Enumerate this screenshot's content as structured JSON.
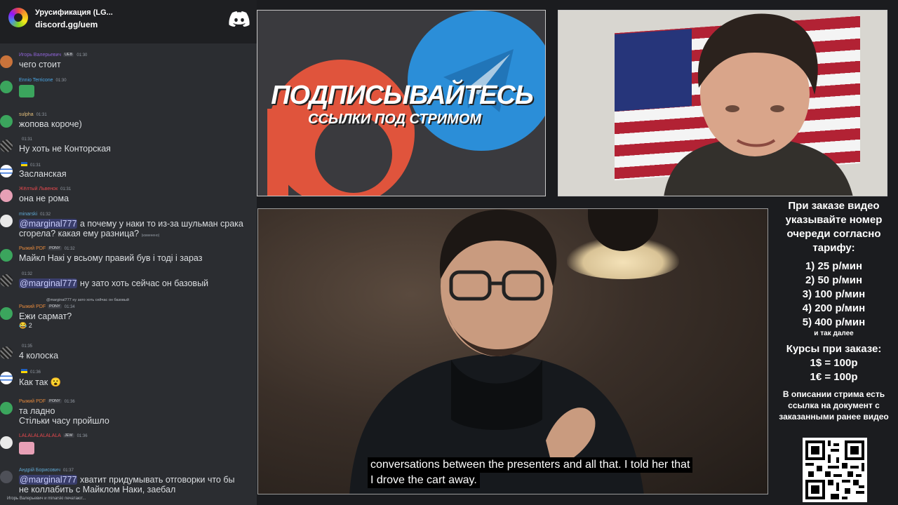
{
  "chat": {
    "server_name": "Урусификация (LG...",
    "invite": "discord.gg/uem",
    "typing": "Игорь Валерьевич и minarski печатают...",
    "messages": [
      {
        "author": "Игорь Валерьевич",
        "author_color": "#8e63d6",
        "time": "01:30",
        "text": "чего стоит"
      },
      {
        "author": "Ennio Terricone",
        "author_color": "#4aa8e8",
        "time": "01:30",
        "text": ""
      },
      {
        "author": "sulpha",
        "author_color": "#e5c07b",
        "time": "01:31",
        "text": "жопова короче)"
      },
      {
        "author": "",
        "author_color": "#dbdee1",
        "time": "01:31",
        "text": "Ну хоть не Конторская"
      },
      {
        "author": "",
        "author_color": "#dbdee1",
        "time": "01:31",
        "text": "Засланская"
      },
      {
        "author": "Жёлтый Львенок",
        "author_color": "#e5484d",
        "time": "01:31",
        "text": "она не рома"
      },
      {
        "author": "minarski",
        "author_color": "#5fa8d3",
        "time": "01:32",
        "mention": "@marginal777",
        "text": " а почему у наки то из-за шульман срака",
        "text2": "сгорела? какая ему разница?",
        "edited": "(изменено)"
      },
      {
        "author": "Рыжий PDF",
        "author_color": "#e68a3d",
        "time": "01:32",
        "badge": "PONY",
        "text": "Майкл Накі у всьому правий був і тоді і зараз"
      },
      {
        "author": "",
        "author_color": "#dbdee1",
        "time": "01:32",
        "mention": "@marginal777",
        "text": " ну зато хоть сейчас он базовый"
      },
      {
        "author": "Рыжий PDF",
        "author_color": "#e68a3d",
        "time": "01:34",
        "badge": "PONY",
        "reply": "@marginal777 ну зато хоть сейчас он базовый",
        "text": "Ежи сармат?",
        "reaction": "😂 2"
      },
      {
        "author": "",
        "author_color": "#dbdee1",
        "time": "01:35",
        "text": "4 колоска"
      },
      {
        "author": "",
        "author_color": "#dbdee1",
        "time": "01:36",
        "text": "Как так 😮"
      },
      {
        "author": "Рыжий PDF",
        "author_color": "#e68a3d",
        "time": "01:36",
        "badge": "PONY",
        "text": "та ладно",
        "text2": "Стільки часу пройшло"
      },
      {
        "author": "LALALALALALALA",
        "author_color": "#e5484d",
        "time": "01:36",
        "badge": "JEW",
        "text": ""
      },
      {
        "author": "Андрій Борисович",
        "author_color": "#5fa8d3",
        "time": "01:37",
        "mention": "@marginal777",
        "text": " хватит придумывать отговорки что бы",
        "text2": "не коллабить с Майклом Наки, заебал"
      }
    ]
  },
  "promo": {
    "title": "ПОДПИСЫВАЙТЕСЬ",
    "subtitle": "ССЫЛКИ ПОД СТРИМОМ"
  },
  "video": {
    "subtitle_line1": "conversations between the presenters and all that. I told her that",
    "subtitle_line2": "I drove the cart away."
  },
  "pricing": {
    "intro": "При заказе видео указывайте номер очереди согласно тарифу:",
    "prices": [
      "1) 25 р/мин",
      "2) 50 р/мин",
      "3) 100 р/мин",
      "4) 200 р/мин",
      "5) 400 р/мин"
    ],
    "more": "и так далее",
    "rates_title": "Курсы при заказе:",
    "rates": [
      "1$ = 100р",
      "1€ = 100р"
    ],
    "doc_note": "В описании стрима есть ссылка на документ с заказанными ранее видео"
  },
  "icons": {
    "discord": "discord-logo-icon",
    "server": "server-icon",
    "qr": "qr-code"
  }
}
